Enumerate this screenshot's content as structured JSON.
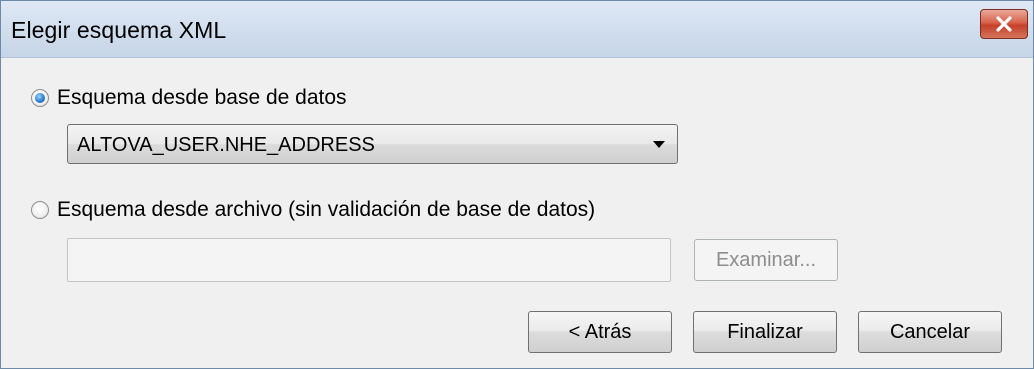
{
  "window": {
    "title": "Elegir esquema XML"
  },
  "options": {
    "from_database_label": "Esquema desde base de datos",
    "from_database_selected": true,
    "from_file_label": "Esquema desde archivo (sin validación de base de datos)",
    "from_file_selected": false
  },
  "schema_select": {
    "value": "ALTOVA_USER.NHE_ADDRESS"
  },
  "file_path": {
    "value": ""
  },
  "buttons": {
    "browse": "Examinar...",
    "back": "< Atrás",
    "finish": "Finalizar",
    "cancel": "Cancelar"
  },
  "icons": {
    "close": "close-icon",
    "dropdown": "chevron-down-icon"
  },
  "colors": {
    "close_button": "#d9624b",
    "radio_selected": "#2a80d0"
  }
}
